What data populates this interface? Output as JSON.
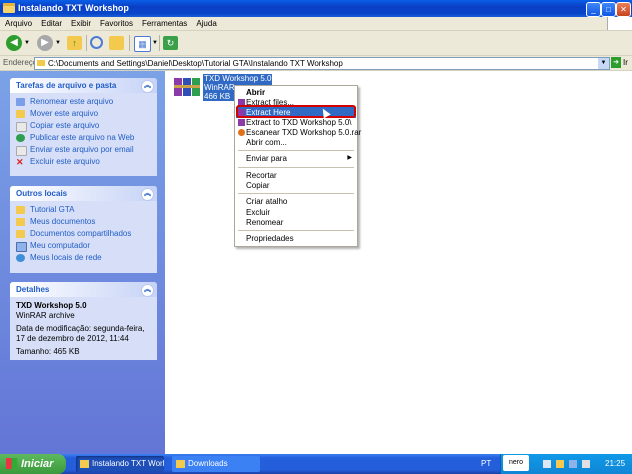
{
  "window": {
    "title": "Instalando TXT Workshop"
  },
  "menu": [
    "Arquivo",
    "Editar",
    "Exibir",
    "Favoritos",
    "Ferramentas",
    "Ajuda"
  ],
  "address": {
    "label": "Endereço",
    "value": "C:\\Documents and Settings\\Daniel\\Desktop\\Tutorial GTA\\Instalando TXT Workshop",
    "go_label": "Ir"
  },
  "tasks_panel": {
    "title": "Tarefas de arquivo e pasta",
    "items": [
      "Renomear este arquivo",
      "Mover este arquivo",
      "Copiar este arquivo",
      "Publicar este arquivo na Web",
      "Enviar este arquivo por email",
      "Excluir este arquivo"
    ]
  },
  "places_panel": {
    "title": "Outros locais",
    "items": [
      "Tutorial GTA",
      "Meus documentos",
      "Documentos compartilhados",
      "Meu computador",
      "Meus locais de rede"
    ]
  },
  "details_panel": {
    "title": "Detalhes",
    "name": "TXD Workshop 5.0",
    "type": "WinRAR archive",
    "modified": "Data de modificação: segunda-feira, 17 de dezembro de 2012, 11:44",
    "size": "Tamanho: 465 KB"
  },
  "file": {
    "name": "TXD Workshop 5.0",
    "type": "WinRAR a",
    "size": "466 KB"
  },
  "context_menu": {
    "items": [
      "Abrir",
      "Extract files...",
      "Extract Here",
      "Extract to TXD Workshop 5.0\\",
      "Escanear TXD Workshop 5.0.rar",
      "Abrir com...",
      "Enviar para",
      "Recortar",
      "Copiar",
      "Criar atalho",
      "Excluir",
      "Renomear",
      "Propriedades"
    ],
    "highlighted": "Extract Here"
  },
  "taskbar": {
    "start": "Iniciar",
    "windows": [
      "Instalando TXT Work...",
      "Downloads"
    ],
    "lang": "PT",
    "nero": "nero",
    "clock": "21:25"
  },
  "colors": {
    "accent": "#316ac5",
    "highlight_ring": "#d40000",
    "taskpane": "#6f8edb"
  }
}
